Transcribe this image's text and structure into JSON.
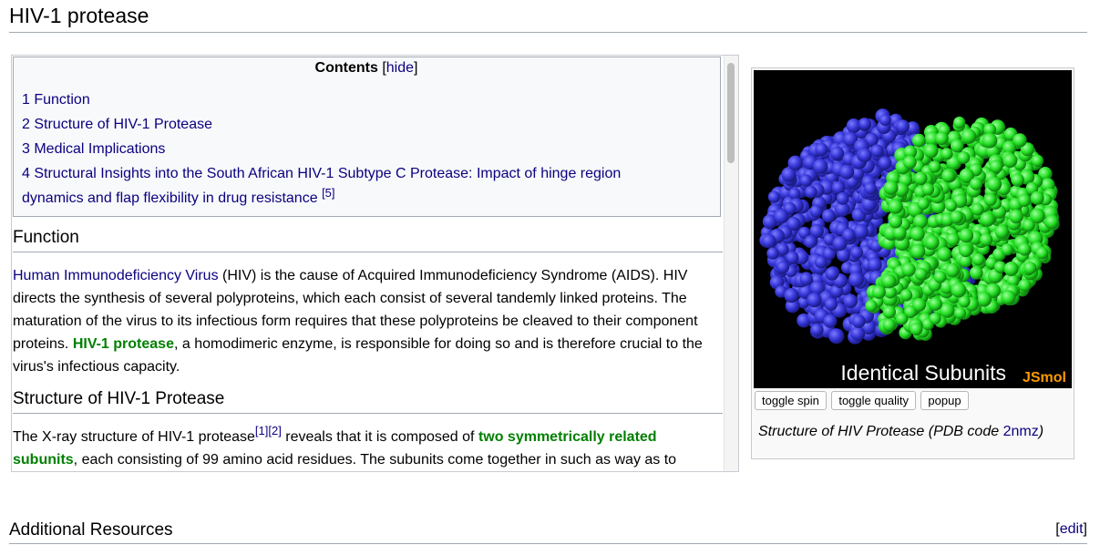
{
  "page": {
    "title": "HIV-1 protease"
  },
  "toc": {
    "title": "Contents",
    "hide_open": "[",
    "hide_label": "hide",
    "hide_close": "]",
    "items": [
      {
        "label": "1 Function"
      },
      {
        "label": "2 Structure of HIV-1 Protease"
      },
      {
        "label": "3 Medical Implications"
      },
      {
        "label_line1": "4 Structural Insights into the South African HIV-1 Subtype C Protease: Impact of hinge region",
        "label_line2": "dynamics and flap flexibility in drug resistance",
        "ref": "[5]"
      }
    ]
  },
  "sections": {
    "function": {
      "heading": "Function",
      "link_hiv": "Human Immunodeficiency Virus",
      "text1": " (HIV) is the cause of Acquired Immunodeficiency Syndrome (AIDS). HIV directs the synthesis of several polyproteins, which each consist of several tandemly linked proteins. The maturation of the virus to its infectious form requires that these polyproteins be cleaved to their component proteins. ",
      "green1": "HIV-1 protease",
      "text2": ", a homodimeric enzyme, is responsible for doing so and is therefore crucial to the virus's infectious capacity."
    },
    "structure": {
      "heading": "Structure of HIV-1 Protease",
      "text1": "The X-ray structure of HIV-1 protease",
      "ref1": "[1]",
      "ref2": "[2]",
      "text2": " reveals that it is composed of ",
      "green1": "two symmetrically related subunits",
      "text3": ", each consisting of 99 amino acid residues. The subunits come together in such as way as to"
    }
  },
  "jsmol": {
    "overlay_title": "Identical Subunits",
    "brand": "JSmol",
    "buttons": {
      "spin": "toggle spin",
      "quality": "toggle quality",
      "popup": "popup"
    },
    "caption_text": "Structure of HIV Protease (PDB code ",
    "caption_link": "2nmz",
    "caption_end": ")",
    "colors": {
      "subunit_a": "#3a3adc",
      "subunit_b": "#22e022",
      "background": "#000000"
    }
  },
  "footer": {
    "heading": "Additional Resources",
    "edit_open": "[",
    "edit_label": "edit",
    "edit_close": "]"
  }
}
